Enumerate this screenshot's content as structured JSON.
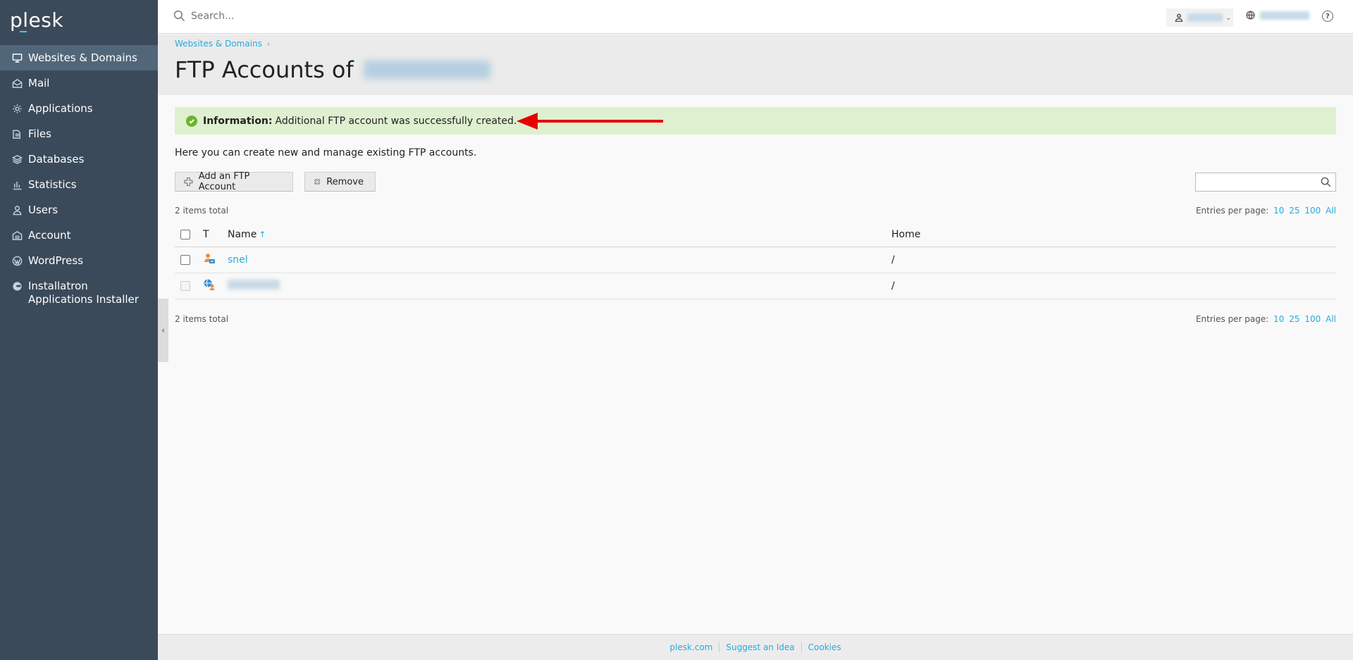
{
  "app": {
    "logo": "plesk"
  },
  "sidebar": {
    "items": [
      {
        "label": "Websites & Domains",
        "icon": "monitor-icon",
        "active": true
      },
      {
        "label": "Mail",
        "icon": "mail-icon"
      },
      {
        "label": "Applications",
        "icon": "gear-icon"
      },
      {
        "label": "Files",
        "icon": "folder-icon"
      },
      {
        "label": "Databases",
        "icon": "layers-icon"
      },
      {
        "label": "Statistics",
        "icon": "bar-chart-icon"
      },
      {
        "label": "Users",
        "icon": "user-icon"
      },
      {
        "label": "Account",
        "icon": "account-icon"
      },
      {
        "label": "WordPress",
        "icon": "wordpress-icon"
      },
      {
        "label": "Installatron Applications Installer",
        "icon": "installatron-icon"
      }
    ]
  },
  "topbar": {
    "search_placeholder": "Search..."
  },
  "header": {
    "breadcrumb": "Websites & Domains",
    "title": "FTP Accounts of"
  },
  "message": {
    "label": "Information:",
    "text": "Additional FTP account was successfully created."
  },
  "description": "Here you can create new and manage existing FTP accounts.",
  "toolbar": {
    "add_label": "Add an FTP Account",
    "remove_label": "Remove"
  },
  "list": {
    "items_total": "2 items total",
    "entries_per_page": "Entries per page:",
    "page_sizes": [
      "10",
      "25",
      "100",
      "All"
    ],
    "columns": {
      "type": "T",
      "name": "Name",
      "sort_indicator": "↑",
      "home": "Home"
    },
    "rows": [
      {
        "name": "snel",
        "home": "/"
      },
      {
        "name": "",
        "home": "/"
      }
    ]
  },
  "footer": {
    "links": [
      "plesk.com",
      "Suggest an Idea",
      "Cookies"
    ]
  },
  "colors": {
    "accent": "#28aade",
    "sidebar": "#3b4a5a",
    "success_bg": "#dff0d0",
    "arrow": "#e60000"
  }
}
